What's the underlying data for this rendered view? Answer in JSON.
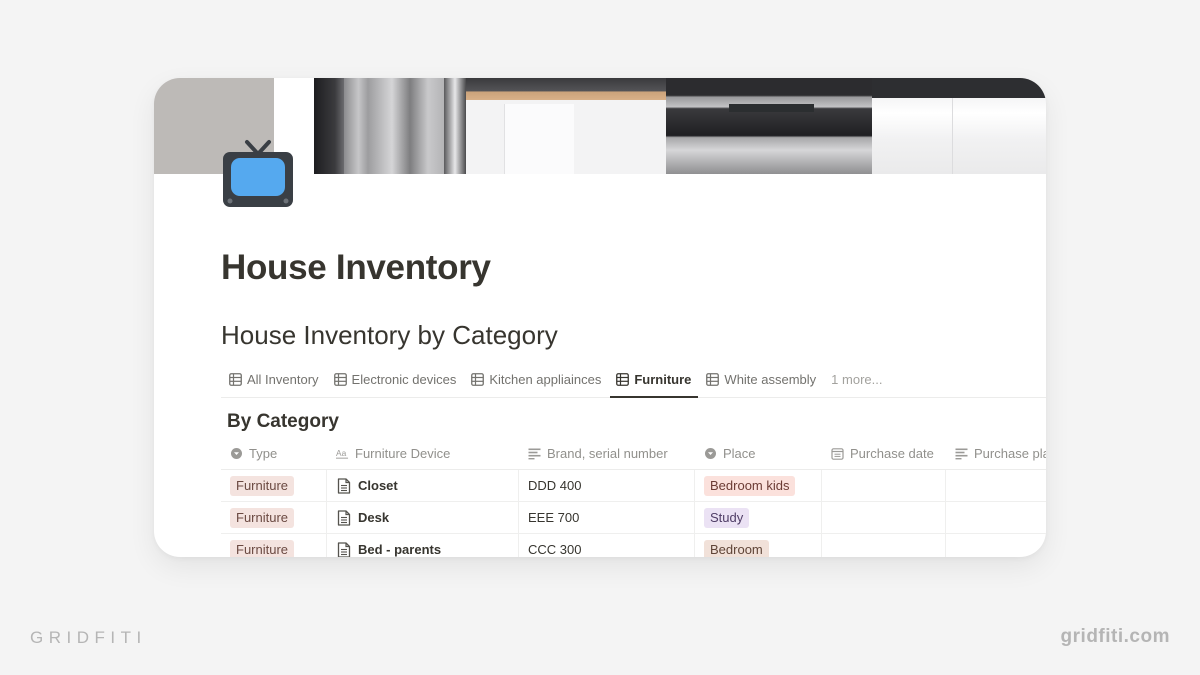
{
  "page": {
    "icon": "television-icon",
    "title": "House Inventory",
    "cover": "kitchen-cover-image"
  },
  "database": {
    "title": "House Inventory by Category",
    "tabs": [
      {
        "label": "All Inventory",
        "icon": "table-icon",
        "active": false
      },
      {
        "label": "Electronic devices",
        "icon": "table-icon",
        "active": false
      },
      {
        "label": "Kitchen appliainces",
        "icon": "table-icon",
        "active": false
      },
      {
        "label": "Furniture",
        "icon": "table-icon",
        "active": true
      },
      {
        "label": "White assembly",
        "icon": "table-icon",
        "active": false
      }
    ],
    "more_tabs_label": "1 more...",
    "view_title": "By Category",
    "columns": [
      {
        "label": "Type",
        "icon": "select-icon"
      },
      {
        "label": "Furniture Device",
        "icon": "title-property-icon"
      },
      {
        "label": "Brand, serial number",
        "icon": "text-property-icon"
      },
      {
        "label": "Place",
        "icon": "select-icon"
      },
      {
        "label": "Purchase date",
        "icon": "calendar-icon"
      },
      {
        "label": "Purchase place",
        "icon": "text-property-icon"
      }
    ],
    "rows": [
      {
        "type": "Furniture",
        "name": "Closet",
        "brand": "DDD 400",
        "place": "Bedroom kids",
        "purchase_date": "",
        "purchase_place": ""
      },
      {
        "type": "Furniture",
        "name": "Desk",
        "brand": "EEE 700",
        "place": "Study",
        "purchase_date": "",
        "purchase_place": ""
      },
      {
        "type": "Furniture",
        "name": "Bed - parents",
        "brand": "CCC 300",
        "place": "Bedroom",
        "purchase_date": "",
        "purchase_place": ""
      }
    ]
  },
  "tag_colors": {
    "Furniture": {
      "bg": "#f4e3df",
      "fg": "#6b4a42"
    },
    "Bedroom kids": {
      "bg": "#fbe1dc",
      "fg": "#6b3b34"
    },
    "Study": {
      "bg": "#ebe2f4",
      "fg": "#4f3d66"
    },
    "Bedroom": {
      "bg": "#f1e1d9",
      "fg": "#5f4437"
    }
  },
  "watermark": {
    "left": "GRIDFITI",
    "right": "gridfiti.com"
  }
}
